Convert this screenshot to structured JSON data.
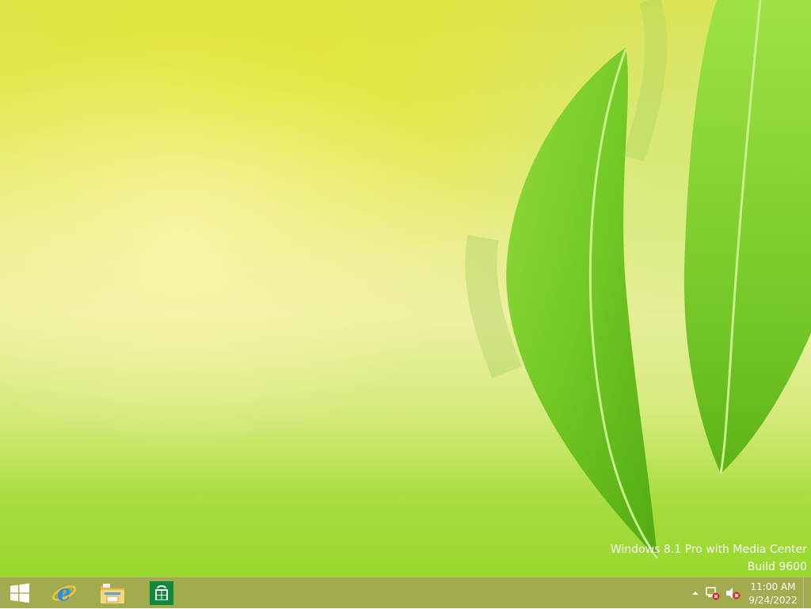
{
  "desktop": {
    "wallpaper": "green-leaves",
    "watermark": {
      "edition": "Windows 8.1 Pro with Media Center",
      "build": "Build 9600"
    }
  },
  "taskbar": {
    "color": "#a2ab4f",
    "pinned": [
      {
        "name": "start-button",
        "icon": "windows-logo-icon"
      },
      {
        "name": "internet-explorer",
        "icon": "internet-explorer-icon"
      },
      {
        "name": "file-explorer",
        "icon": "file-explorer-icon"
      },
      {
        "name": "store",
        "icon": "store-icon"
      }
    ],
    "tray": {
      "overflow_icon": "chevron-up-icon",
      "network_icon": "network-disconnected-icon",
      "volume_icon": "volume-muted-icon",
      "time": "11:00 AM",
      "date": "9/24/2022"
    }
  }
}
